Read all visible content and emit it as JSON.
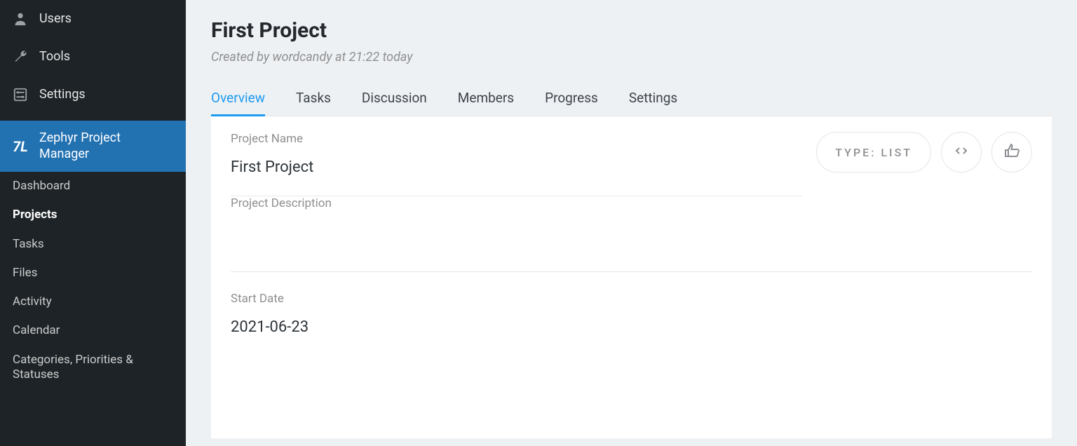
{
  "sidebar": {
    "top": [
      {
        "icon": "user",
        "label": "Users"
      },
      {
        "icon": "wrench",
        "label": "Tools"
      },
      {
        "icon": "sliders",
        "label": "Settings"
      }
    ],
    "active": {
      "label": "Zephyr Project Manager"
    },
    "sub": [
      {
        "label": "Dashboard",
        "bold": false
      },
      {
        "label": "Projects",
        "bold": true
      },
      {
        "label": "Tasks",
        "bold": false
      },
      {
        "label": "Files",
        "bold": false
      },
      {
        "label": "Activity",
        "bold": false
      },
      {
        "label": "Calendar",
        "bold": false
      },
      {
        "label": "Categories, Priorities & Statuses",
        "bold": false
      }
    ]
  },
  "header": {
    "title": "First Project",
    "subtitle": "Created by wordcandy at 21:22 today"
  },
  "tabs": [
    {
      "label": "Overview",
      "active": true
    },
    {
      "label": "Tasks",
      "active": false
    },
    {
      "label": "Discussion",
      "active": false
    },
    {
      "label": "Members",
      "active": false
    },
    {
      "label": "Progress",
      "active": false
    },
    {
      "label": "Settings",
      "active": false
    }
  ],
  "type_pill": "TYPE: LIST",
  "fields": {
    "name": {
      "label": "Project Name",
      "value": "First Project"
    },
    "description": {
      "label": "Project Description",
      "value": ""
    },
    "start_date": {
      "label": "Start Date",
      "value": "2021-06-23"
    }
  }
}
